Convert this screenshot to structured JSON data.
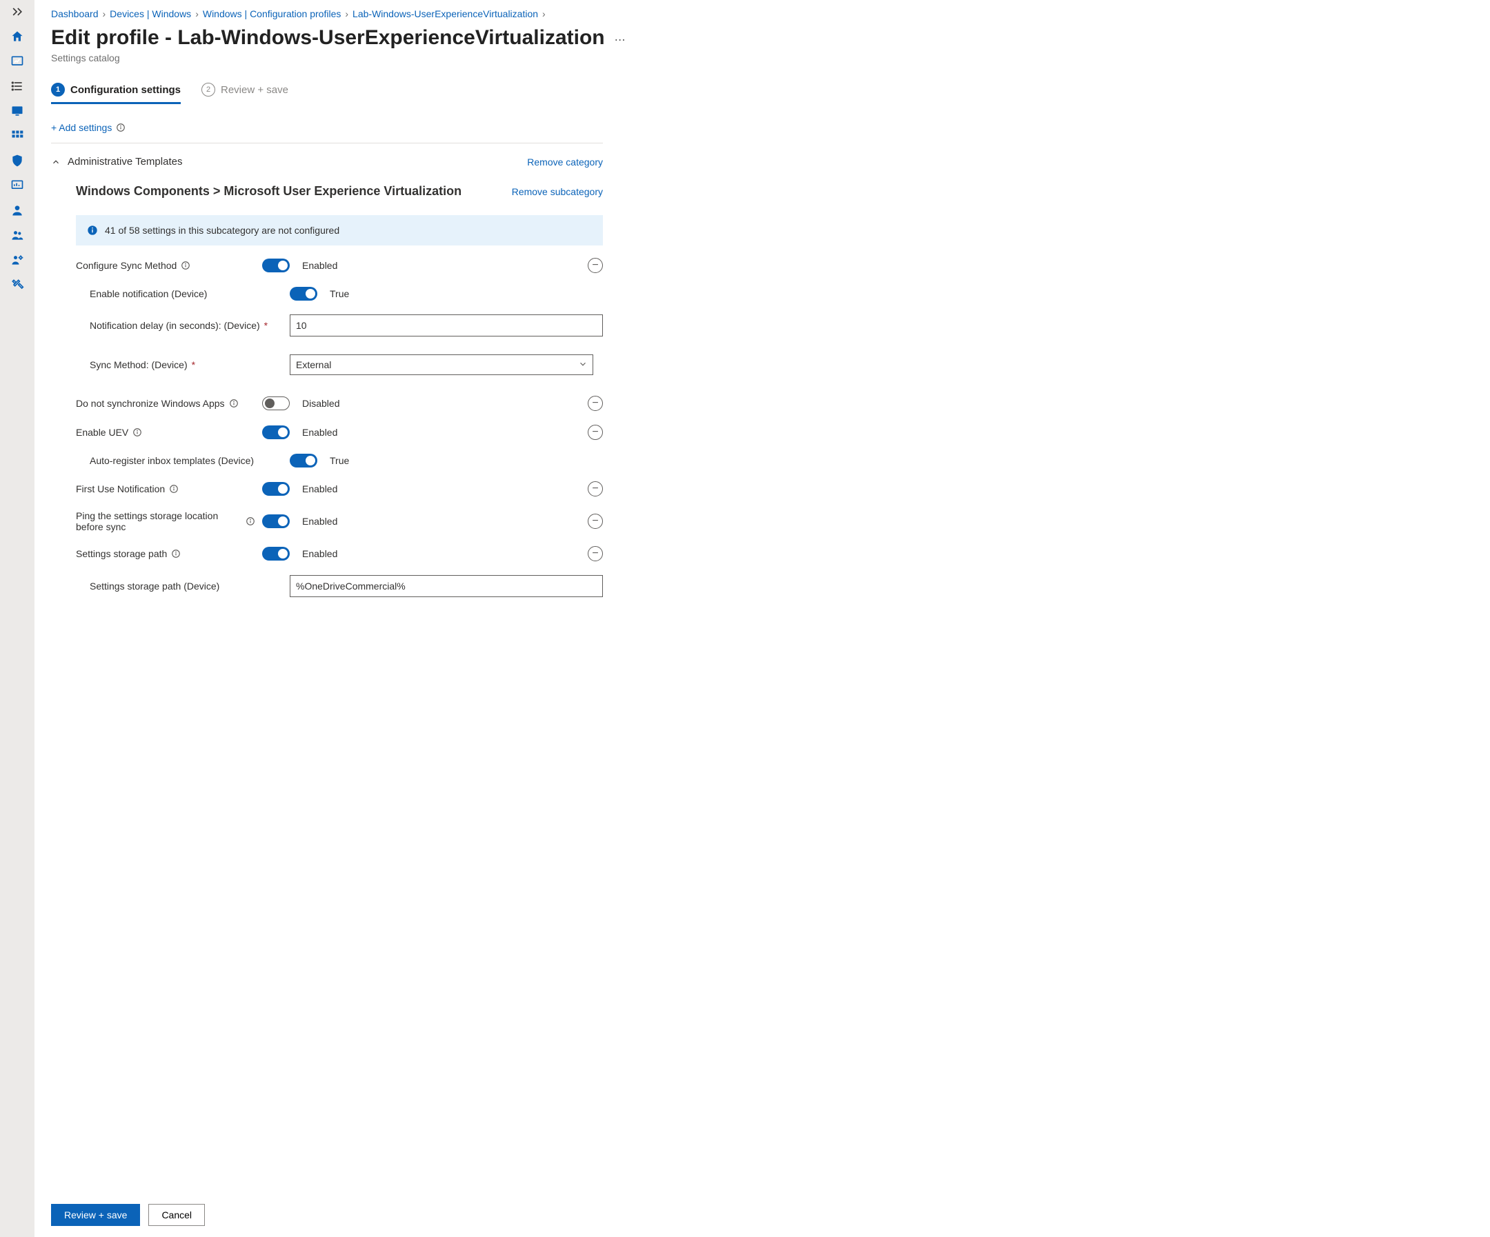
{
  "breadcrumb": {
    "dashboard": "Dashboard",
    "devices": "Devices | Windows",
    "profiles": "Windows | Configuration profiles",
    "profile": "Lab-Windows-UserExperienceVirtualization"
  },
  "header": {
    "title": "Edit profile - Lab-Windows-UserExperienceVirtualization",
    "subtitle": "Settings catalog"
  },
  "wizard": {
    "step1": "Configuration settings",
    "step2": "Review + save"
  },
  "add_settings": "+ Add settings",
  "category": {
    "name": "Administrative Templates",
    "remove": "Remove category"
  },
  "subcategory": {
    "title": "Windows Components > Microsoft User Experience Virtualization",
    "remove": "Remove subcategory",
    "banner": "41 of 58 settings in this subcategory are not configured"
  },
  "labels": {
    "enabled": "Enabled",
    "disabled": "Disabled",
    "true": "True"
  },
  "settings": {
    "configureSync": {
      "label": "Configure Sync Method"
    },
    "enableNotification": {
      "label": "Enable notification (Device)"
    },
    "notificationDelay": {
      "label": "Notification delay (in seconds): (Device)",
      "value": "10"
    },
    "syncMethod": {
      "label": "Sync Method: (Device)",
      "value": "External"
    },
    "dontSyncApps": {
      "label": "Do not synchronize Windows Apps"
    },
    "enableUEV": {
      "label": "Enable UEV"
    },
    "autoRegister": {
      "label": "Auto-register inbox templates (Device)"
    },
    "firstUse": {
      "label": "First Use Notification"
    },
    "ping": {
      "label": "Ping the settings storage location before sync"
    },
    "storagePath": {
      "label": "Settings storage path"
    },
    "storagePathValue": {
      "label": "Settings storage path (Device)",
      "value": "%OneDriveCommercial%"
    }
  },
  "footer": {
    "primary": "Review + save",
    "cancel": "Cancel"
  }
}
